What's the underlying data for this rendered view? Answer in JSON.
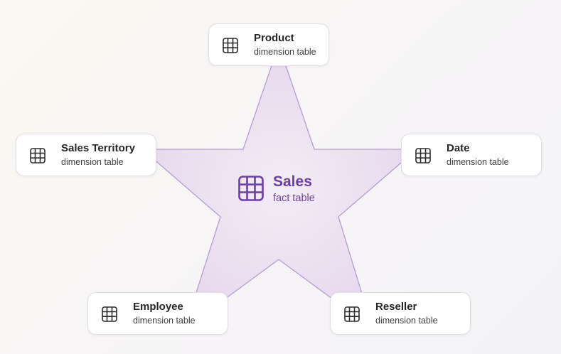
{
  "fact": {
    "title": "Sales",
    "subtitle": "fact table",
    "icon": "table-icon",
    "color": "#6b3fa8"
  },
  "dimensions": [
    {
      "title": "Product",
      "subtitle": "dimension table",
      "icon": "table-icon"
    },
    {
      "title": "Sales Territory",
      "subtitle": "dimension table",
      "icon": "table-icon"
    },
    {
      "title": "Date",
      "subtitle": "dimension table",
      "icon": "table-icon"
    },
    {
      "title": "Employee",
      "subtitle": "dimension table",
      "icon": "table-icon"
    },
    {
      "title": "Reseller",
      "subtitle": "dimension table",
      "icon": "table-icon"
    }
  ],
  "colors": {
    "star_fill": "#e9ddf0",
    "star_stroke": "#b49ed1",
    "card_border": "#e0dde5"
  }
}
